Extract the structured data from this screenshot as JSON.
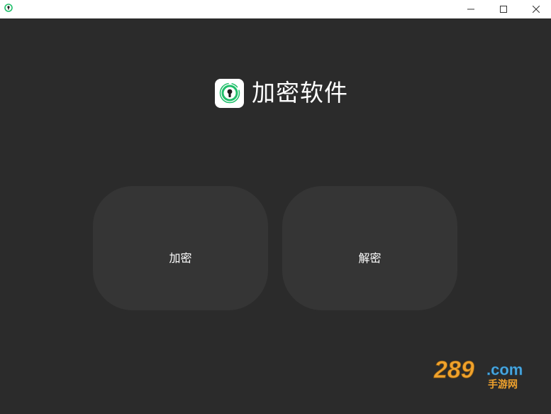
{
  "window": {
    "background": "#2b2b2b",
    "titlebar_background": "#ffffff",
    "icons": {
      "app": "keyhole-icon",
      "minimize": "minimize-icon",
      "maximize": "maximize-icon",
      "close": "close-icon"
    }
  },
  "header": {
    "title": "加密软件",
    "logo_icon": "keyhole-icon",
    "accent": "#1fbf6a"
  },
  "actions": {
    "encrypt_label": "加密",
    "decrypt_label": "解密",
    "button_color": "#353535"
  },
  "watermark": {
    "brand": "289",
    "domain": ".com",
    "subtitle": "手游网"
  }
}
